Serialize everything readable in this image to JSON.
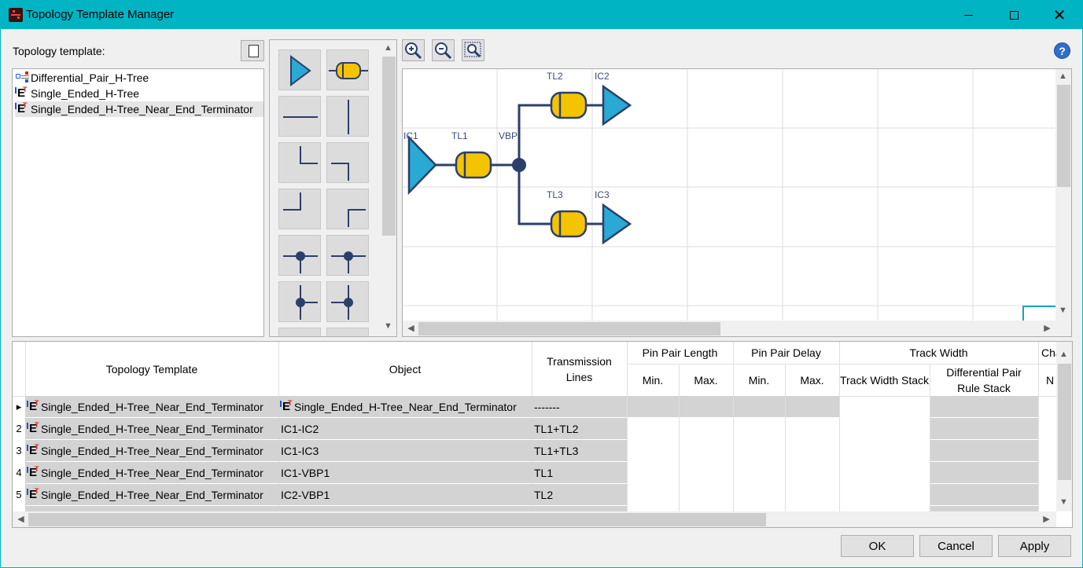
{
  "window": {
    "title": "Topology Template Manager"
  },
  "left_panel": {
    "label": "Topology template:",
    "templates": [
      {
        "name": "Differential_Pair_H-Tree",
        "icon": "differential-pair-icon",
        "selected": false
      },
      {
        "name": "Single_Ended_H-Tree",
        "icon": "et-template-icon",
        "selected": false
      },
      {
        "name": "Single_Ended_H-Tree_Near_End_Terminator",
        "icon": "et-template-icon",
        "selected": true
      }
    ]
  },
  "palette": {
    "items": [
      "ic-triangle-icon",
      "transmission-line-icon",
      "horizontal-line-icon",
      "vertical-line-icon",
      "corner-bottom-left-icon",
      "corner-top-right-icon",
      "corner-top-left-icon",
      "corner-bottom-right-icon",
      "cross-junction-icon",
      "tee-down-junction-icon",
      "tee-left-junction-icon",
      "tee-right-junction-icon"
    ]
  },
  "diagram": {
    "labels": {
      "ic1": "IC1",
      "tl1": "TL1",
      "vbp": "VBP",
      "tl2": "TL2",
      "ic2": "IC2",
      "tl3": "TL3",
      "ic3": "IC3"
    },
    "colors": {
      "wire": "#2b3f6b",
      "ic": "#29a9d4",
      "tl": "#f5c400"
    }
  },
  "grid": {
    "headers": {
      "topology_template": "Topology Template",
      "object": "Object",
      "transmission_lines": "Transmission Lines",
      "pin_pair_length": "Pin Pair Length",
      "pin_pair_delay": "Pin Pair Delay",
      "track_width": "Track Width",
      "min": "Min.",
      "max": "Max.",
      "track_width_stack": "Track Width Stack",
      "diff_pair_rule_stack": "Differential Pair Rule Stack",
      "cha": "Cha",
      "cha2": "N"
    },
    "rows": [
      {
        "num": "▸",
        "template": "Single_Ended_H-Tree_Near_End_Terminator",
        "object": "Single_Ended_H-Tree_Near_End_Terminator",
        "lines": "-------"
      },
      {
        "num": "2",
        "template": "Single_Ended_H-Tree_Near_End_Terminator",
        "object": "IC1-IC2",
        "lines": "TL1+TL2"
      },
      {
        "num": "3",
        "template": "Single_Ended_H-Tree_Near_End_Terminator",
        "object": "IC1-IC3",
        "lines": "TL1+TL3"
      },
      {
        "num": "4",
        "template": "Single_Ended_H-Tree_Near_End_Terminator",
        "object": "IC1-VBP1",
        "lines": "TL1"
      },
      {
        "num": "5",
        "template": "Single_Ended_H-Tree_Near_End_Terminator",
        "object": "IC2-VBP1",
        "lines": "TL2"
      }
    ]
  },
  "buttons": {
    "ok": "OK",
    "cancel": "Cancel",
    "apply": "Apply"
  }
}
